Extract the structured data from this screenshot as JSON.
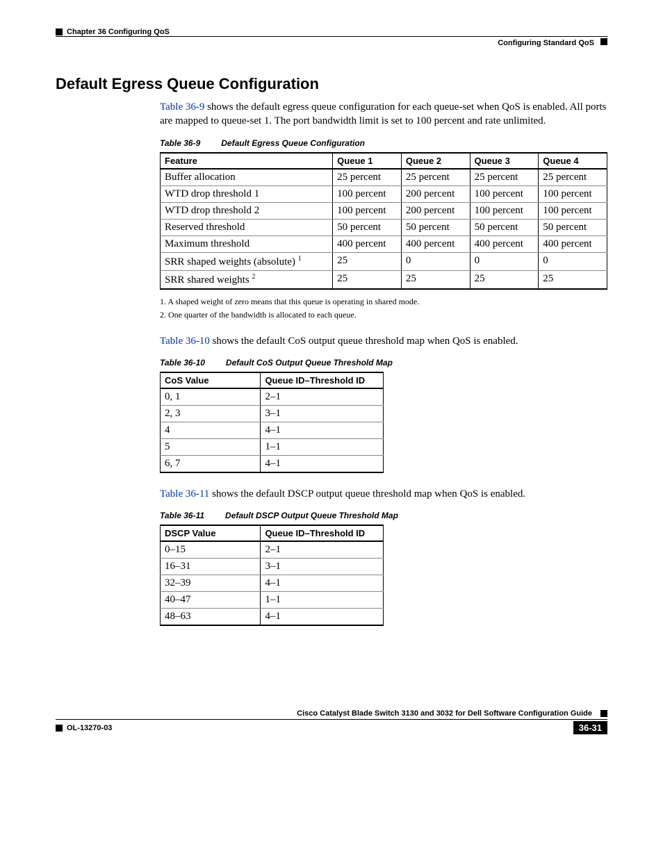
{
  "header": {
    "chapter": "Chapter 36      Configuring QoS",
    "section": "Configuring Standard QoS"
  },
  "title": "Default Egress Queue Configuration",
  "intro_link": "Table 36-9",
  "intro_rest": " shows the default egress queue configuration for each queue-set when QoS is enabled. All ports are mapped to queue-set 1. The port bandwidth limit is set to 100 percent and rate unlimited.",
  "table9": {
    "cap_num": "Table 36-9",
    "cap_title": "Default Egress Queue Configuration",
    "headers": [
      "Feature",
      "Queue 1",
      "Queue 2",
      "Queue 3",
      "Queue 4"
    ],
    "rows": [
      [
        "Buffer allocation",
        "25 percent",
        "25 percent",
        "25 percent",
        "25 percent"
      ],
      [
        "WTD drop threshold 1",
        "100 percent",
        "200 percent",
        "100 percent",
        "100 percent"
      ],
      [
        "WTD drop threshold 2",
        "100 percent",
        "200 percent",
        "100 percent",
        "100 percent"
      ],
      [
        "Reserved threshold",
        "50 percent",
        "50 percent",
        "50 percent",
        "50 percent"
      ],
      [
        "Maximum threshold",
        "400 percent",
        "400 percent",
        "400 percent",
        "400 percent"
      ],
      [
        "__SRR_SHAPED__",
        "25",
        "0",
        "0",
        "0"
      ],
      [
        "__SRR_SHARED__",
        "25",
        "25",
        "25",
        "25"
      ]
    ],
    "srr_shaped_label": "SRR shaped weights (absolute)",
    "srr_shared_label": "SRR shared weights",
    "fn1": "1.  A shaped weight of zero means that this queue is operating in shared mode.",
    "fn2": "2.  One quarter of the bandwidth is allocated to each queue."
  },
  "para2_link": "Table 36-10",
  "para2_rest": " shows the default CoS output queue threshold map when QoS is enabled.",
  "table10": {
    "cap_num": "Table 36-10",
    "cap_title": "Default CoS Output Queue Threshold Map",
    "headers": [
      "CoS Value",
      "Queue ID–Threshold ID"
    ],
    "rows": [
      [
        "0, 1",
        "2–1"
      ],
      [
        "2, 3",
        "3–1"
      ],
      [
        "4",
        "4–1"
      ],
      [
        "5",
        "1–1"
      ],
      [
        "6, 7",
        "4–1"
      ]
    ]
  },
  "para3_link": "Table 36-11",
  "para3_rest": " shows the default DSCP output queue threshold map when QoS is enabled.",
  "table11": {
    "cap_num": "Table 36-11",
    "cap_title": "Default DSCP Output Queue Threshold Map",
    "headers": [
      "DSCP Value",
      "Queue ID–Threshold ID"
    ],
    "rows": [
      [
        "0–15",
        "2–1"
      ],
      [
        "16–31",
        "3–1"
      ],
      [
        "32–39",
        "4–1"
      ],
      [
        "40–47",
        "1–1"
      ],
      [
        "48–63",
        "4–1"
      ]
    ]
  },
  "footer": {
    "guide": "Cisco Catalyst Blade Switch 3130 and 3032 for Dell Software Configuration Guide",
    "doc": "OL-13270-03",
    "page": "36-31"
  }
}
